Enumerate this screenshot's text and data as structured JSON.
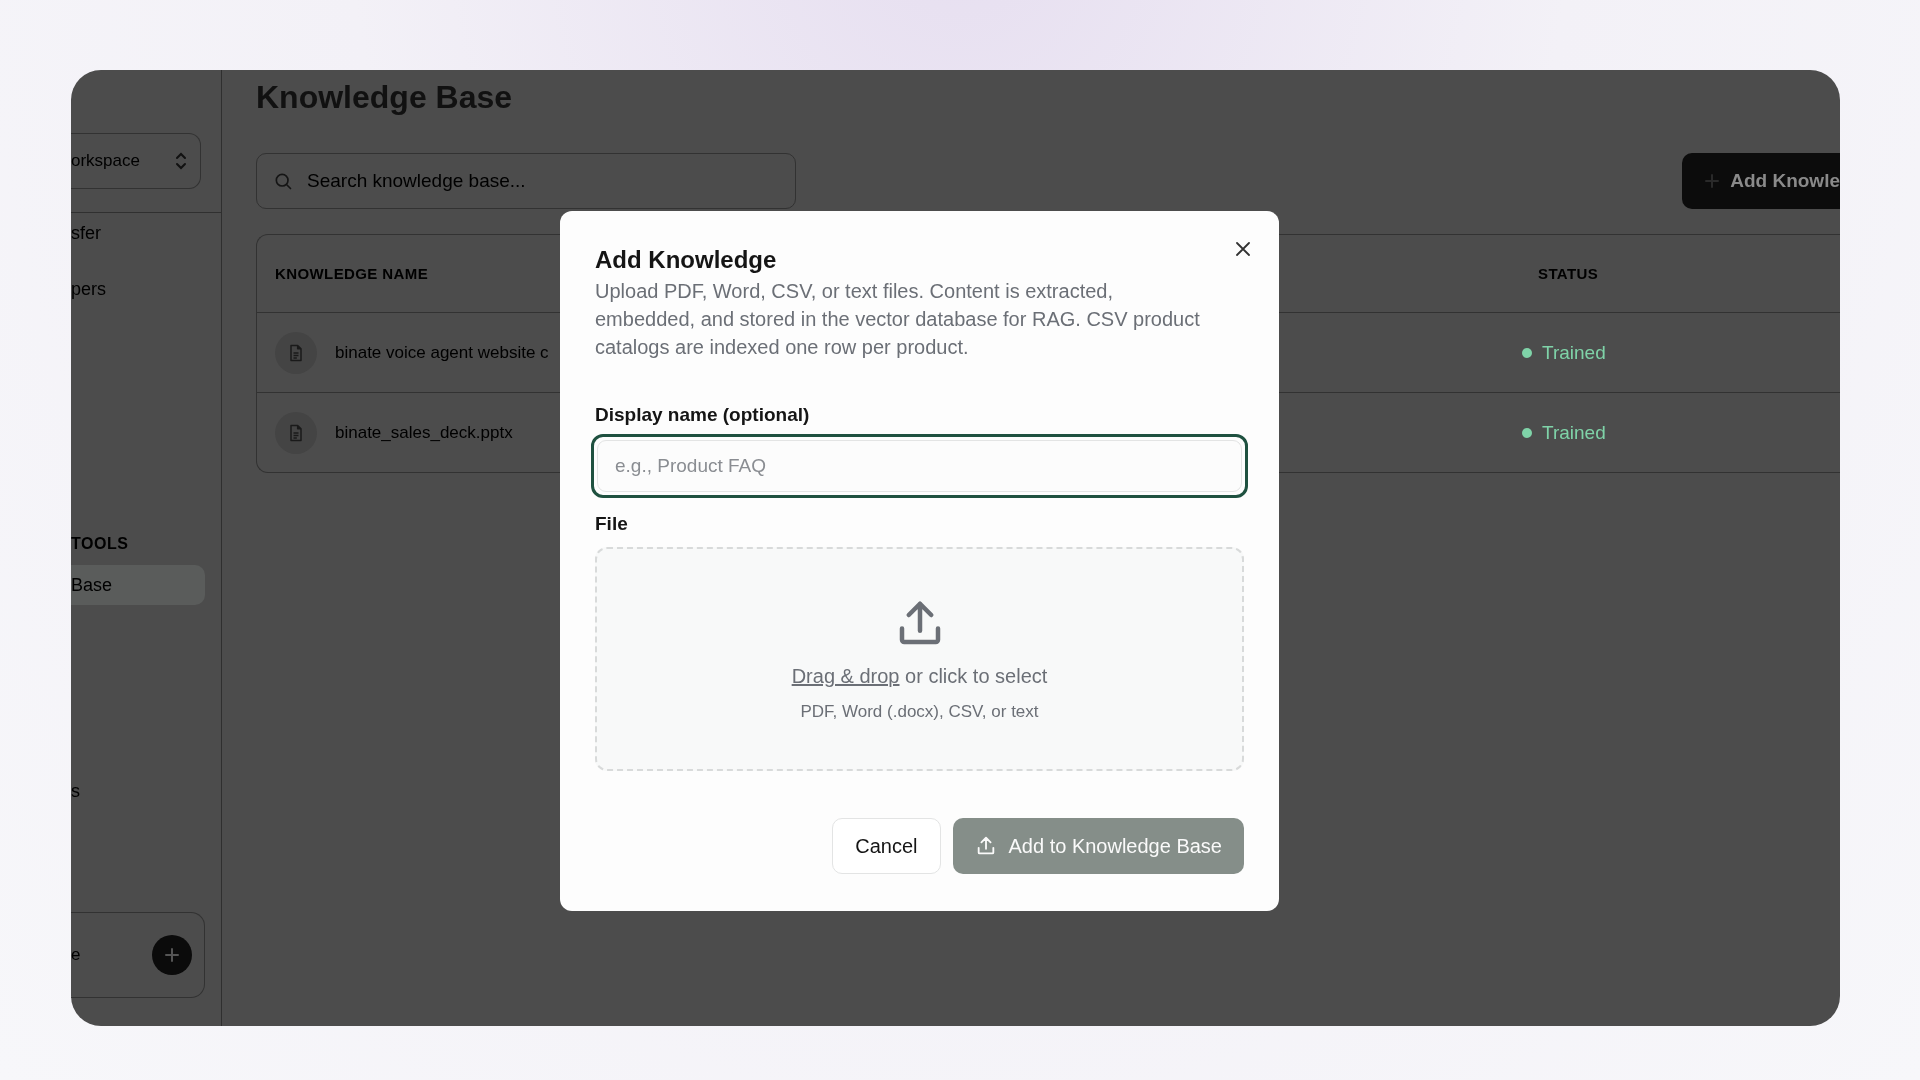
{
  "sidebar": {
    "workspace": "orkspace",
    "items": [
      {
        "label": "sfer",
        "selected": false
      },
      {
        "label": "pers",
        "selected": false
      }
    ],
    "section": "TOOLS",
    "tools": [
      {
        "label": "Base",
        "selected": true
      },
      {
        "label": "s",
        "selected": false
      }
    ],
    "footer": {
      "label": "e"
    }
  },
  "page": {
    "title": "Knowledge Base",
    "search": {
      "placeholder": "Search knowledge base..."
    },
    "add_button": "Add Knowle"
  },
  "table": {
    "columns": [
      "KNOWLEDGE NAME",
      "STATUS"
    ],
    "rows": [
      {
        "name": "binate voice agent website c",
        "status": "Trained",
        "color": "#7fd3a8"
      },
      {
        "name": "binate_sales_deck.pptx",
        "status": "Trained",
        "color": "#7fd3a8"
      }
    ]
  },
  "dialog": {
    "title": "Add Knowledge",
    "description": "Upload PDF, Word, CSV, or text files. Content is extracted, embedded, and stored in the vector database for RAG. CSV product catalogs are indexed one row per product.",
    "name_label": "Display name (optional)",
    "name_field": {
      "placeholder": "e.g., Product FAQ",
      "focused": true
    },
    "file_label": "File",
    "dropzone": {
      "link": "Drag & drop",
      "text": "or click to select",
      "hint": "PDF, Word (.docx), CSV, or text"
    },
    "buttons": [
      {
        "label": "Cancel",
        "kind": "secondary",
        "disabled": false
      },
      {
        "label": "Add to Knowledge Base",
        "kind": "primary",
        "disabled": true
      }
    ]
  }
}
